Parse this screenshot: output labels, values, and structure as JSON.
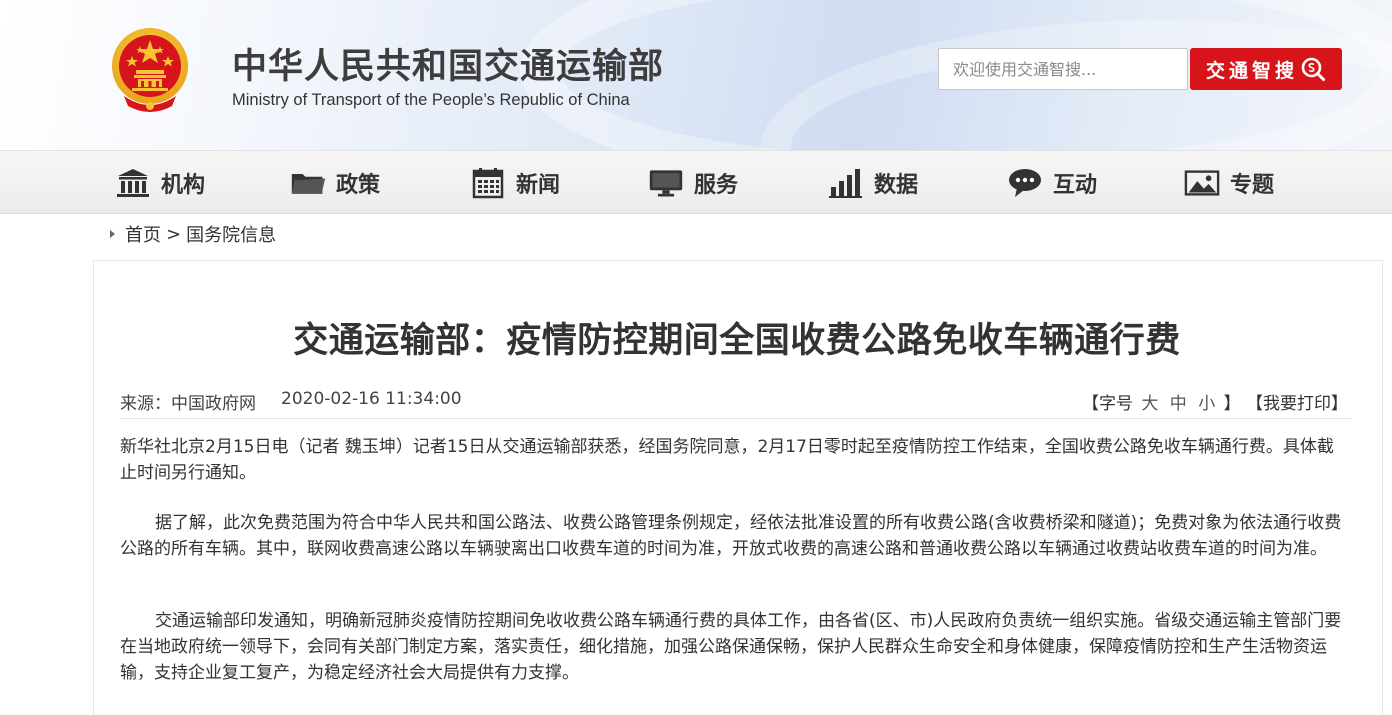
{
  "header": {
    "title_cn": "中华人民共和国交通运输部",
    "title_en": "Ministry of Transport of the People’s Republic of China",
    "search_placeholder": "欢迎使用交通智搜...",
    "search_button": "交通智搜"
  },
  "nav": [
    {
      "label": "机构",
      "icon": "institution-icon"
    },
    {
      "label": "政策",
      "icon": "folder-icon"
    },
    {
      "label": "新闻",
      "icon": "calendar-icon"
    },
    {
      "label": "服务",
      "icon": "monitor-icon"
    },
    {
      "label": "数据",
      "icon": "bar-chart-icon"
    },
    {
      "label": "互动",
      "icon": "chat-icon"
    },
    {
      "label": "专题",
      "icon": "image-icon"
    }
  ],
  "breadcrumb": {
    "home": "首页",
    "separator": ">",
    "current": "国务院信息"
  },
  "article": {
    "title": "交通运输部：疫情防控期间全国收费公路免收车辆通行费",
    "source": "来源：中国政府网",
    "date": "2020-02-16 11:34:00",
    "font_size_label": "【字号",
    "font_size_large": "大",
    "font_size_medium": "中",
    "font_size_small": "小",
    "font_size_close": "】",
    "print_label": "【我要打印】",
    "paragraphs": [
      "新华社北京2月15日电（记者 魏玉坤）记者15日从交通运输部获悉，经国务院同意，2月17日零时起至疫情防控工作结束，全国收费公路免收车辆通行费。具体截止时间另行通知。",
      "据了解，此次免费范围为符合中华人民共和国公路法、收费公路管理条例规定，经依法批准设置的所有收费公路(含收费桥梁和隧道)；免费对象为依法通行收费公路的所有车辆。其中，联网收费高速公路以车辆驶离出口收费车道的时间为准，开放式收费的高速公路和普通收费公路以车辆通过收费站收费车道的时间为准。",
      "交通运输部印发通知，明确新冠肺炎疫情防控期间免收收费公路车辆通行费的具体工作，由各省(区、市)人民政府负责统一组织实施。省级交通运输主管部门要在当地政府统一领导下，会同有关部门制定方案，落实责任，细化措施，加强公路保通保畅，保护人民群众生命安全和身体健康，保障疫情防控和生产生活物资运输，支持企业复工复产，为稳定经济社会大局提供有力支撑。"
    ]
  },
  "colors": {
    "accent_red": "#d7141a",
    "text": "#333333",
    "emblem_red": "#d5151b",
    "emblem_gold": "#f7c531"
  }
}
